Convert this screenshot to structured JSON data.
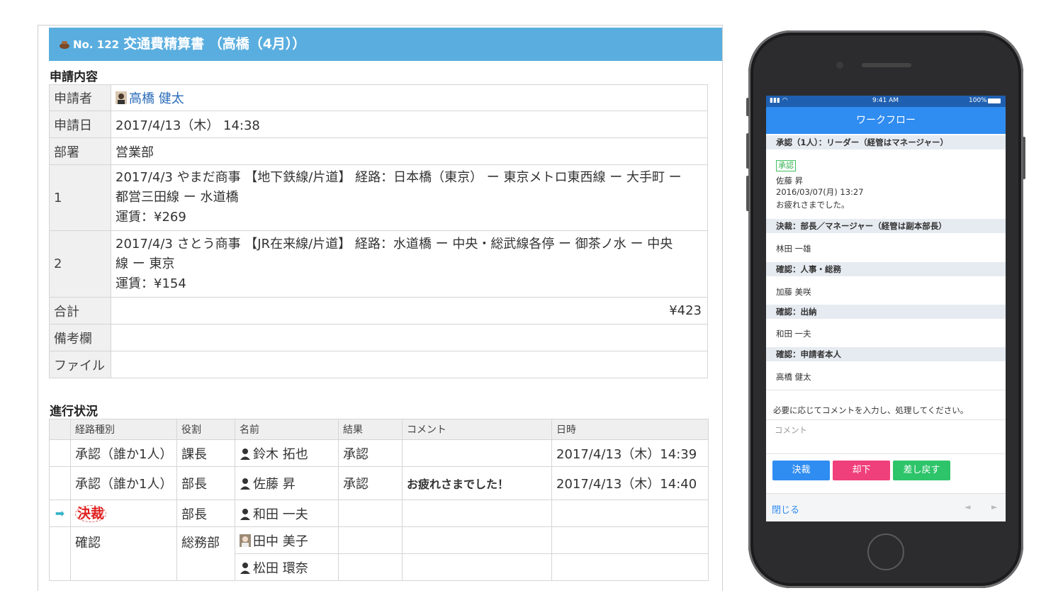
{
  "desktop": {
    "title_number": "No. 122",
    "title": "交通費精算書 （高橋（4月））",
    "application_section": "申請内容",
    "rows": {
      "applicant_label": "申請者",
      "applicant_value": "高橋 健太",
      "date_label": "申請日",
      "date_value": "2017/4/13（木） 14:38",
      "dept_label": "部署",
      "dept_value": "営業部",
      "item1_label": "1",
      "item1_line1": "2017/4/3 やまだ商事 【地下鉄線/片道】 経路：日本橋（東京） ー 東京メトロ東西線 ー 大手町 ー",
      "item1_line2": "都営三田線 ー 水道橋",
      "item1_line3": "運賃：¥269",
      "item2_label": "2",
      "item2_line1": "2017/4/3 さとう商事 【JR在来線/片道】 経路：水道橋 ー 中央・総武線各停 ー 御茶ノ水 ー 中央",
      "item2_line2": "線 ー 東京",
      "item2_line3": "運賃：¥154",
      "total_label": "合計",
      "total_value": "¥423",
      "notes_label": "備考欄",
      "notes_value": "",
      "file_label": "ファイル",
      "file_value": ""
    },
    "progress_section": "進行状況",
    "progress_headers": [
      "経路種別",
      "役割",
      "名前",
      "結果",
      "コメント",
      "日時"
    ],
    "progress_rows": [
      {
        "type": "承認（誰か1人）",
        "role": "課長",
        "name": "鈴木 拓也",
        "result": "承認",
        "comment": "",
        "datetime": "2017/4/13（木）14:39"
      },
      {
        "type": "承認（誰か1人）",
        "role": "部長",
        "name": "佐藤 昇",
        "result": "承認",
        "comment": "お疲れさまでした！",
        "datetime": "2017/4/13（木）14:40"
      },
      {
        "type": "決裁",
        "role": "部長",
        "name": "和田 一夫",
        "result": "",
        "comment": "",
        "datetime": ""
      },
      {
        "type": "確認",
        "role": "総務部",
        "name": "田中 美子",
        "result": "",
        "comment": "",
        "datetime": ""
      },
      {
        "type": "",
        "role": "",
        "name": "松田 環奈",
        "result": "",
        "comment": "",
        "datetime": ""
      }
    ]
  },
  "phone": {
    "status_time": "9:41 AM",
    "status_battery": "100%",
    "nav_title": "ワークフロー",
    "step1_header": "承認（1人）：リーダー（経管はマネージャー）",
    "step1_badge": "承認",
    "step1_name": "佐藤 昇",
    "step1_date": "2016/03/07(月) 13:27",
    "step1_comment": "お疲れさまでした。",
    "step2_header": "決裁：部長／マネージャー（経管は副本部長）",
    "step2_name": "林田 一雄",
    "step3_header": "確認：人事・総務",
    "step3_name": "加藤 美咲",
    "step4_header": "確認：出納",
    "step4_name": "和田 一夫",
    "step5_header": "確認：申請者本人",
    "step5_name": "高橋 健太",
    "instruction": "必要に応じてコメントを入力し、処理してください。",
    "comment_placeholder": "コメント",
    "btn_approve": "決裁",
    "btn_reject": "却下",
    "btn_return": "差し戻す",
    "close_link": "閉じる",
    "colors": {
      "approve": "#2f8cf0",
      "reject": "#f0407c",
      "return": "#2ec46a"
    }
  }
}
